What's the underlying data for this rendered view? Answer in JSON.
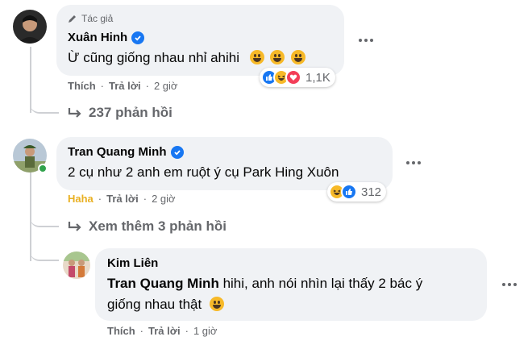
{
  "comments": [
    {
      "badge": "Tác giả",
      "author": "Xuân Hinh",
      "verified": true,
      "text": "Ừ cũng giống nhau nhỉ ahihi",
      "emoji_count": 3,
      "actions": {
        "like": "Thích",
        "reply": "Trả lời",
        "time": "2 giờ"
      },
      "reactions": {
        "icons": [
          "like",
          "haha",
          "love"
        ],
        "count": "1,1K"
      },
      "replies_label": "237 phản hồi"
    },
    {
      "author": "Tran Quang Minh",
      "verified": true,
      "text": "2 cụ như 2 anh em ruột ý cụ Park Hing Xuôn",
      "actions": {
        "like": "Haha",
        "reply": "Trả lời",
        "time": "2 giờ"
      },
      "reactions": {
        "icons": [
          "haha",
          "like"
        ],
        "count": "312"
      },
      "replies_label": "Xem thêm 3 phản hồi"
    },
    {
      "author": "Kim Liên",
      "mention": "Tran Quang Minh",
      "text_line1": "hihi, anh nói nhìn lại thấy 2 bác ý",
      "text_line2": "giống nhau thật",
      "actions": {
        "like": "Thích",
        "reply": "Trả lời",
        "time": "1 giờ"
      }
    }
  ],
  "colors": {
    "bubble": "#f0f2f5",
    "secondary_text": "#65676b",
    "verified_blue": "#1877f2",
    "haha_yellow": "#e9b022",
    "thread_line": "#ced0d4"
  }
}
